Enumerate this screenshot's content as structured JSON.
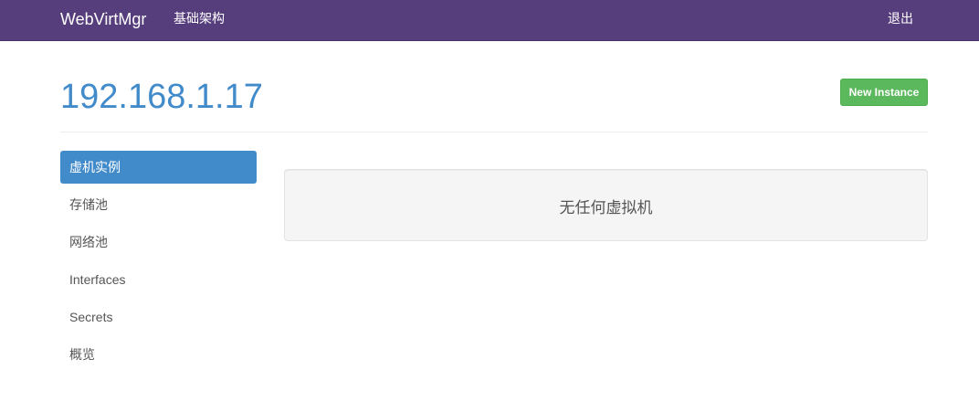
{
  "navbar": {
    "brand": "WebVirtMgr",
    "infrastructure_label": "基础架构",
    "logout_label": "退出"
  },
  "header": {
    "title": "192.168.1.17",
    "new_instance_label": "New Instance"
  },
  "sidebar": {
    "items": [
      {
        "label": "虚机实例",
        "active": true
      },
      {
        "label": "存储池",
        "active": false
      },
      {
        "label": "网络池",
        "active": false
      },
      {
        "label": "Interfaces",
        "active": false
      },
      {
        "label": "Secrets",
        "active": false
      },
      {
        "label": "概览",
        "active": false
      }
    ]
  },
  "main": {
    "empty_message": "无任何虚拟机"
  },
  "colors": {
    "navbar_bg": "#563d7c",
    "accent": "#428bca",
    "success": "#5cb85c"
  }
}
